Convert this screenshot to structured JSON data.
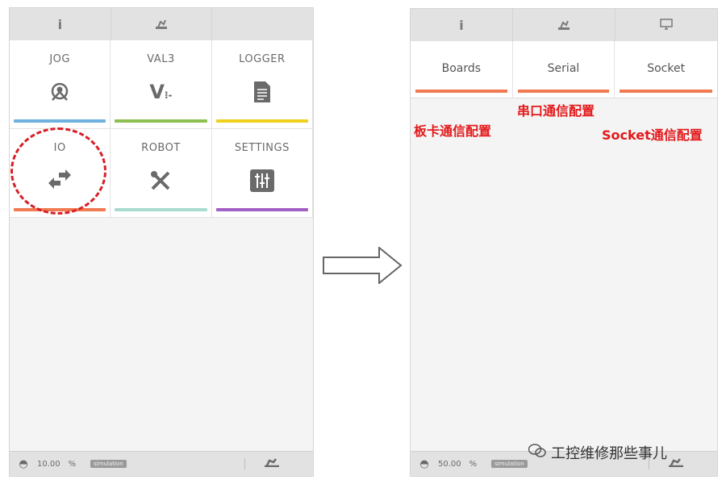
{
  "colors": {
    "jog_bar": "#6fb2e0",
    "val3_bar": "#8cc152",
    "logger_bar": "#f0d01a",
    "io_bar": "#f07a52",
    "robot_bar": "#a8dcd1",
    "settings_bar": "#a25fc4",
    "tab_bar": "#f07a52",
    "annotation": "#e4191b"
  },
  "left": {
    "topbar": {
      "info_icon": "i",
      "robot_icon": "robot-arm-icon"
    },
    "tiles": [
      {
        "label": "JOG",
        "icon": "jog-icon"
      },
      {
        "label": "VAL3",
        "icon": "val3-icon"
      },
      {
        "label": "LOGGER",
        "icon": "document-icon"
      },
      {
        "label": "IO",
        "icon": "io-arrows-icon"
      },
      {
        "label": "ROBOT",
        "icon": "robot-tools-icon"
      },
      {
        "label": "SETTINGS",
        "icon": "sliders-icon"
      }
    ],
    "status": {
      "speed": "10.00",
      "unit": "%",
      "mode": "simulation"
    }
  },
  "right": {
    "topbar": {
      "info_icon": "i",
      "robot_icon": "robot-arm-icon",
      "monitor_icon": "monitor-icon"
    },
    "tabs": [
      {
        "label": "Boards"
      },
      {
        "label": "Serial"
      },
      {
        "label": "Socket"
      }
    ],
    "annotations": {
      "boards": "板卡通信配置",
      "serial": "串口通信配置",
      "socket": "Socket通信配置"
    },
    "status": {
      "speed": "50.00",
      "unit": "%",
      "mode": "simulation"
    }
  },
  "watermark": "工控维修那些事儿"
}
